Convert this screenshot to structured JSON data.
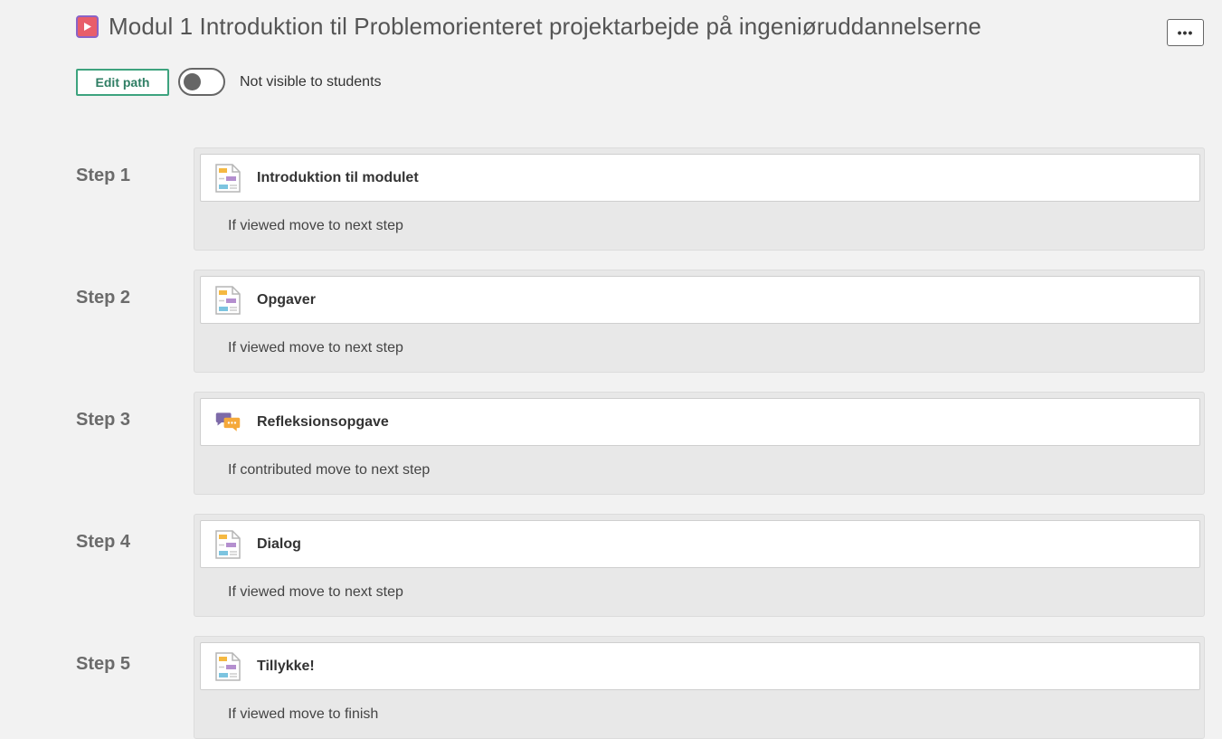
{
  "header": {
    "title": "Modul 1 Introduktion til Problemorienteret projektarbejde på ingeniøruddannelserne",
    "more_label": "•••"
  },
  "controls": {
    "edit_label": "Edit path",
    "visibility_label": "Not visible to students",
    "visible_to_students": false
  },
  "steps": [
    {
      "label": "Step 1",
      "title": "Introduktion til modulet",
      "condition": "If viewed move to next step",
      "icon": "page-icon"
    },
    {
      "label": "Step 2",
      "title": "Opgaver",
      "condition": "If viewed move to next step",
      "icon": "page-icon"
    },
    {
      "label": "Step 3",
      "title": "Refleksionsopgave",
      "condition": "If contributed move to next step",
      "icon": "discussion-icon"
    },
    {
      "label": "Step 4",
      "title": "Dialog",
      "condition": "If viewed move to next step",
      "icon": "page-icon"
    },
    {
      "label": "Step 5",
      "title": "Tillykke!",
      "condition": "If viewed move to finish",
      "icon": "page-icon"
    }
  ],
  "colors": {
    "accent_green": "#3da37e",
    "path_icon_red": "#e85e6a",
    "path_icon_purple": "#8a63c7"
  }
}
